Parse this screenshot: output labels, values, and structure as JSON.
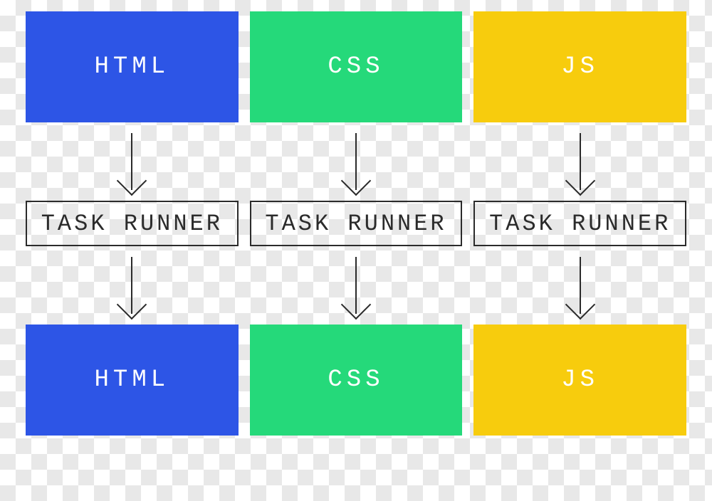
{
  "colors": {
    "html": "#2d55e6",
    "css": "#25d97a",
    "js": "#f7cc0d",
    "stroke": "#2b2b2b"
  },
  "columns": [
    {
      "key": "html",
      "input_label": "HTML",
      "runner_label": "TASK RUNNER",
      "output_label": "HTML"
    },
    {
      "key": "css",
      "input_label": "CSS",
      "runner_label": "TASK RUNNER",
      "output_label": "CSS"
    },
    {
      "key": "js",
      "input_label": "JS",
      "runner_label": "TASK RUNNER",
      "output_label": "JS"
    }
  ]
}
